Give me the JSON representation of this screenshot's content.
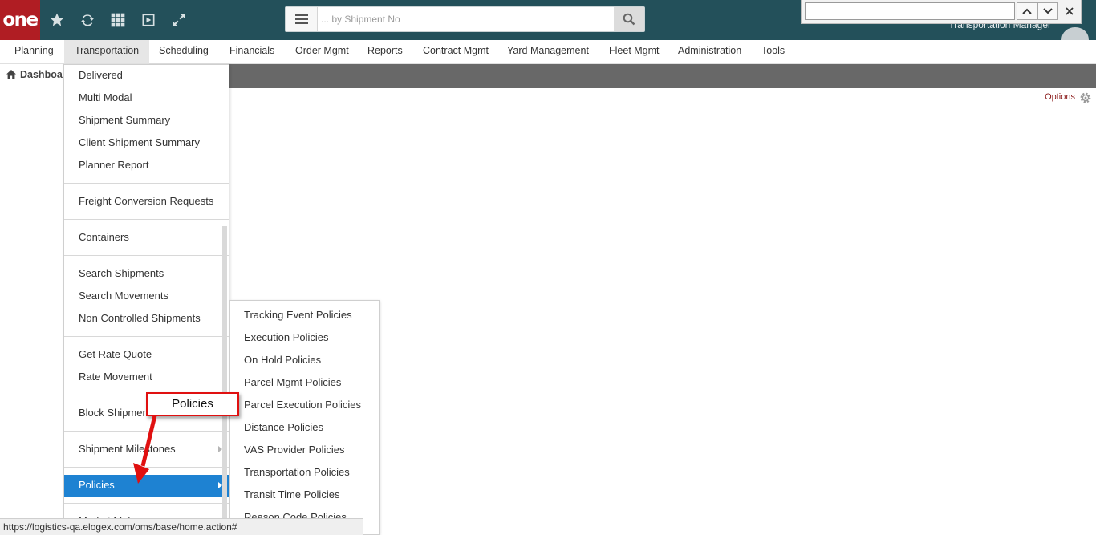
{
  "app": {
    "logo_text": "one",
    "brand_color": "#b01d23",
    "topbar_color": "#23505a"
  },
  "toolbar": {
    "icons": [
      "star-icon",
      "refresh-icon",
      "apps-grid-icon",
      "play-icon",
      "expand-icon"
    ]
  },
  "search": {
    "placeholder": "... by Shipment No"
  },
  "user": {
    "role": "Transportation Manager"
  },
  "find_bar": {
    "value": ""
  },
  "nav": {
    "items": [
      "Planning",
      "Transportation",
      "Scheduling",
      "Financials",
      "Order Mgmt",
      "Reports",
      "Contract Mgmt",
      "Yard Management",
      "Fleet Mgmt",
      "Administration",
      "Tools"
    ],
    "active": "Transportation"
  },
  "breadcrumb": {
    "label": "Dashboa"
  },
  "options": {
    "label": "Options"
  },
  "dropdown": {
    "items": [
      "Delivered",
      "Multi Modal",
      "Shipment Summary",
      "Client Shipment Summary",
      "Planner Report",
      "Freight Conversion Requests",
      "Containers",
      "Search Shipments",
      "Search Movements",
      "Non Controlled Shipments",
      "Get Rate Quote",
      "Rate Movement",
      "Block Shipments",
      "Shipment Milestones",
      "Policies",
      "Market Make"
    ],
    "selected": "Policies",
    "selected_color": "#1e82d2"
  },
  "submenu": {
    "items": [
      "Tracking Event Policies",
      "Execution Policies",
      "On Hold Policies",
      "Parcel Mgmt Policies",
      "Parcel Execution Policies",
      "Distance Policies",
      "VAS Provider Policies",
      "Transportation Policies",
      "Transit Time Policies",
      "Reason Code Policies"
    ]
  },
  "callout": {
    "text": "Policies",
    "color": "#e01010"
  },
  "status_bar": {
    "url": "https://logistics-qa.elogex.com/oms/base/home.action#"
  }
}
